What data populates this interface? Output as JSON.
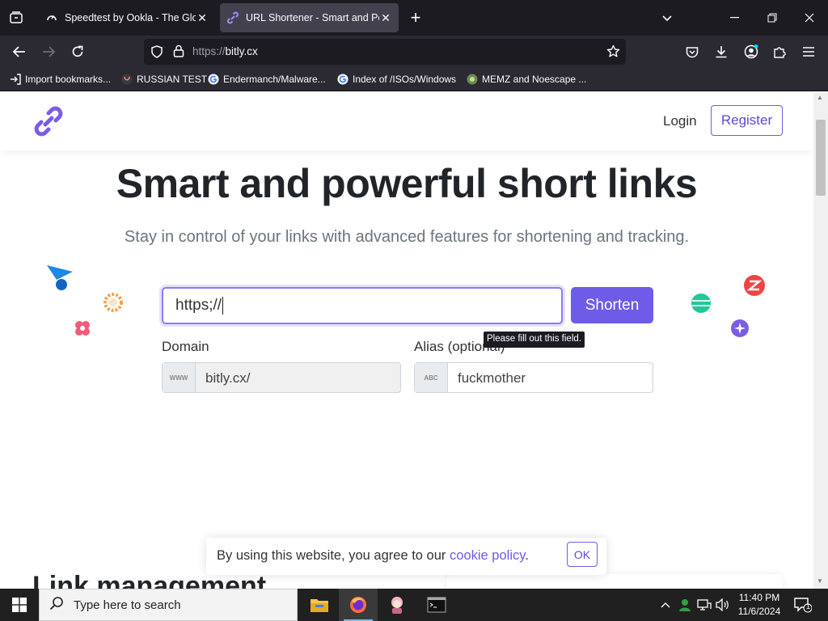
{
  "browser": {
    "tabs": [
      {
        "title": "Speedtest by Ookla - The Global",
        "active": false
      },
      {
        "title": "URL Shortener - Smart and Powerful",
        "active": true
      }
    ],
    "url_scheme": "https://",
    "url_host": "bitly.cx",
    "bookmarks": [
      {
        "label": "Import bookmarks...",
        "icon": "import-icon"
      },
      {
        "label": "RUSSIAN TEST",
        "icon": "github-icon"
      },
      {
        "label": "Endermanch/Malware...",
        "icon": "google-icon"
      },
      {
        "label": "Index of /ISOs/Windows",
        "icon": "google-icon"
      },
      {
        "label": "MEMZ and Noescape ...",
        "icon": "site-icon"
      }
    ]
  },
  "site": {
    "nav": {
      "login": "Login",
      "register": "Register"
    },
    "hero": {
      "headline": "Smart and powerful short links",
      "subtitle": "Stay in control of your links with advanced features for shortening and tracking."
    },
    "form": {
      "url_value": "https;//",
      "shorten_label": "Shorten",
      "tooltip": "Please fill out this field.",
      "domain_label": "Domain",
      "domain_prefix": "WWW",
      "domain_value": "bitly.cx/",
      "alias_label": "Alias (optional)",
      "alias_prefix": "ABC",
      "alias_value": "fuckmother"
    },
    "cookie": {
      "text": "By using this website, you agree to our",
      "link": "cookie policy",
      "period": ".",
      "ok": "OK"
    },
    "section2_title": "Link management"
  },
  "taskbar": {
    "search_placeholder": "Type here to search",
    "time": "11:40 PM",
    "date": "11/6/2024",
    "notification_count": "1"
  },
  "colors": {
    "accent": "#6c5ce7",
    "browser_dark": "#1c1b22",
    "toolbar": "#2b2a33"
  }
}
